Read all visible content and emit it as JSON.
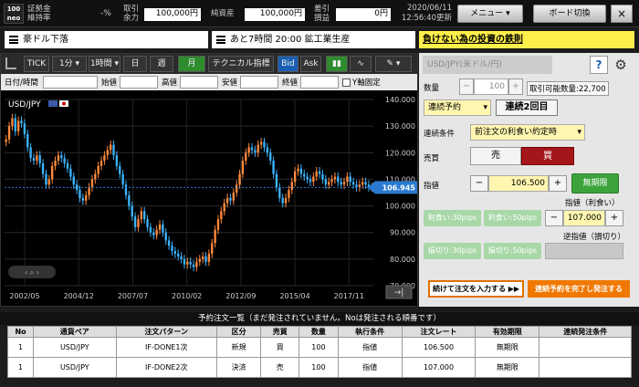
{
  "topbar": {
    "logo": "100 neo",
    "margin_rate_label": "証拠金\n維持率",
    "margin_rate_value": "",
    "margin_rate_unit": "-%",
    "trade_margin_label": "取引\n余力",
    "trade_margin_value": "100,000",
    "trade_margin_unit": "円",
    "net_assets_label": "純資産",
    "net_assets_value": "100,000",
    "net_assets_unit": "円",
    "pnl_label": "差引\n損益",
    "pnl_value": "0",
    "pnl_unit": "円",
    "date": "2020/06/11",
    "time": "12:56:40更新",
    "menu_label": "メニュー",
    "board_label": "ボード切換",
    "close_label": "×"
  },
  "news": {
    "item1": "豪ドル下落",
    "item2": "あと7時間 20:00 鉱工業生産",
    "link": "負けない為の投資の鉄則"
  },
  "chart_toolbar": {
    "tick": "TICK",
    "period1": "1分",
    "period2": "1時間",
    "day": "日",
    "week": "週",
    "month": "月",
    "technical": "テクニカル指標",
    "bid": "Bid",
    "ask": "Ask"
  },
  "ohlc": {
    "datetime_label": "日付/時間",
    "open_label": "始値",
    "high_label": "高値",
    "low_label": "安値",
    "close_label": "終値",
    "yfix_label": "Y軸固定"
  },
  "chart_data": {
    "type": "candlestick",
    "title": "USD/JPY",
    "yticks": [
      140.0,
      130.0,
      120.0,
      110.0,
      100.0,
      90.0,
      80.0,
      70.0
    ],
    "ylim": [
      70,
      140
    ],
    "xticks": [
      "2002/05",
      "2004/12",
      "2007/07",
      "2010/02",
      "2012/09",
      "2015/04",
      "2017/11"
    ],
    "current_price": "106.945",
    "closes": [
      125,
      130,
      133,
      128,
      132,
      131,
      127,
      122,
      118,
      117,
      119,
      116,
      112,
      108,
      110,
      115,
      117,
      119,
      118,
      116,
      114,
      111,
      108,
      106,
      103,
      102,
      104,
      107,
      110,
      112,
      115,
      117,
      119,
      121,
      123,
      119,
      115,
      112,
      108,
      104,
      100,
      96,
      92,
      95,
      98,
      95,
      92,
      90,
      89,
      91,
      93,
      90,
      87,
      85,
      83,
      82,
      81,
      80,
      78,
      79,
      78,
      77,
      79,
      80,
      81,
      79,
      82,
      86,
      91,
      95,
      98,
      101,
      103,
      102,
      105,
      108,
      112,
      117,
      120,
      122,
      121,
      120,
      123,
      124,
      122,
      120,
      117,
      112,
      107,
      103,
      101,
      103,
      106,
      109,
      113,
      114,
      112,
      111,
      110,
      109,
      111,
      113,
      112,
      110,
      108,
      109,
      110,
      111,
      109,
      108,
      109,
      111,
      109,
      108,
      107,
      108,
      109,
      108,
      107,
      107
    ]
  },
  "order_panel": {
    "pair": "USD/JPY(米ドル/円)",
    "qty_label": "数量",
    "qty_value": "100",
    "tradable_label": "取引可能数量:",
    "tradable_value": "22,700",
    "order_type": "連続予約",
    "order_count": "連続2回目",
    "cond_label": "連続条件",
    "cond_value": "前注文の利食い約定時",
    "side_label": "売買",
    "sell": "売",
    "buy": "買",
    "price_label": "指値",
    "price_value": "106.500",
    "unlimited": "無期限",
    "tp_label": "指値（利食い）",
    "tp_value": "107.000",
    "tp30": "利食い:30pips",
    "tp50": "利食い:50pips",
    "sl_label": "逆指値（損切り）",
    "sl30": "損切り:30pips",
    "sl50": "損切り:50pips",
    "continue_btn": "続けて注文を入力する",
    "confirm_btn": "連続予約を完了し発注する",
    "minus": "−",
    "plus": "+"
  },
  "orders": {
    "title": "予約注文一覧（まだ発注されていません。Noは発注される順番です）",
    "headers": [
      "No",
      "通貨ペア",
      "注文パターン",
      "区分",
      "売買",
      "数量",
      "執行条件",
      "注文レート",
      "有効期限",
      "連続発注条件"
    ],
    "rows": [
      [
        "1",
        "USD/JPY",
        "IF-DONE1次",
        "新規",
        "買",
        "100",
        "指値",
        "106.500",
        "無期限",
        ""
      ],
      [
        "1",
        "USD/JPY",
        "IF-DONE2次",
        "決済",
        "売",
        "100",
        "指値",
        "107.000",
        "無期限",
        ""
      ]
    ]
  }
}
